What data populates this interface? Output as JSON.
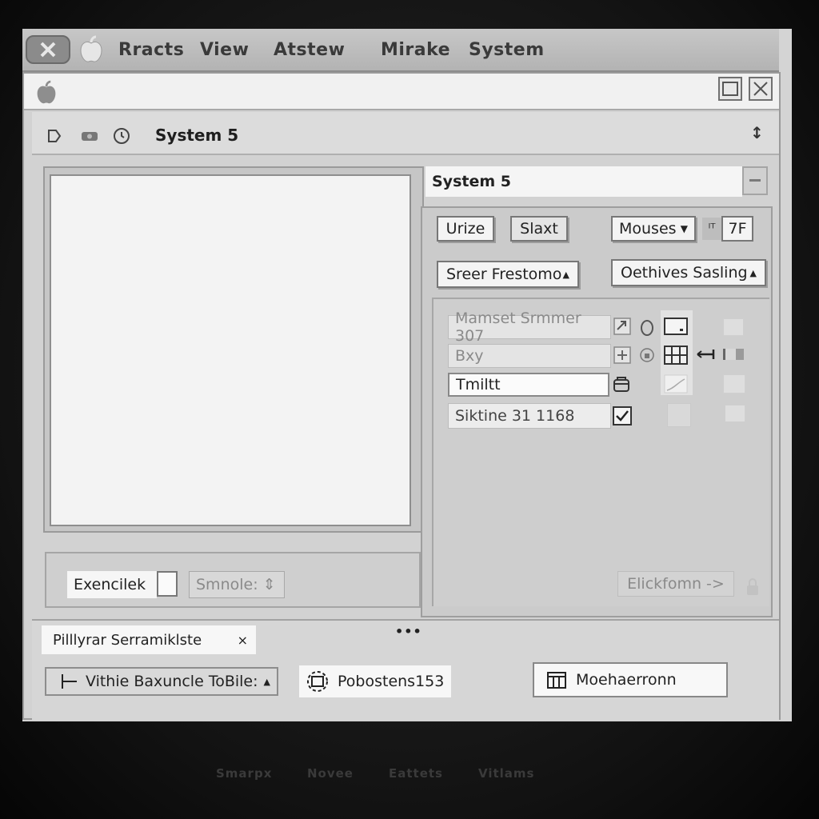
{
  "menubar": {
    "items": [
      "Rracts",
      "View",
      "Atstew",
      "Mirake",
      "System"
    ]
  },
  "toolbar": {
    "title": "System 5",
    "right_glyph": "↕"
  },
  "right_header": {
    "title": "System 5"
  },
  "right_panel": {
    "btn_1": "Urize",
    "btn_2": "Slaxt",
    "dropdown_1": "Mouses",
    "small_icon": "ᴵᵀ",
    "value_box": "7F",
    "dropdown_2": "Sreer Frestomo",
    "dropdown_3": "Oethives Sasling"
  },
  "form": {
    "row_1": "Mamset Srmmer 307",
    "row_2": "Bxy",
    "row_3": "Tmiltt",
    "row_4": "Siktine 31 1168",
    "disabled_button": "Elickfomn ->"
  },
  "lower_left": {
    "field_label": "Exencilek",
    "ghost_button": "Smnole: ⇕"
  },
  "status": {
    "chip": "Pilllyrar Serramiklste",
    "chip_close": "×",
    "dots": "•••",
    "dropdown": "Vithie Baxuncle ToBile:",
    "badge": "Pobostens153",
    "field": "Moehaerronn"
  },
  "taskbar": {
    "items": [
      "Smarpx",
      "Novee",
      "Eattets",
      "Vitlams"
    ]
  },
  "icons": {
    "apple": "apple-icon",
    "close": "close-icon",
    "maximize": "maximize-icon"
  }
}
